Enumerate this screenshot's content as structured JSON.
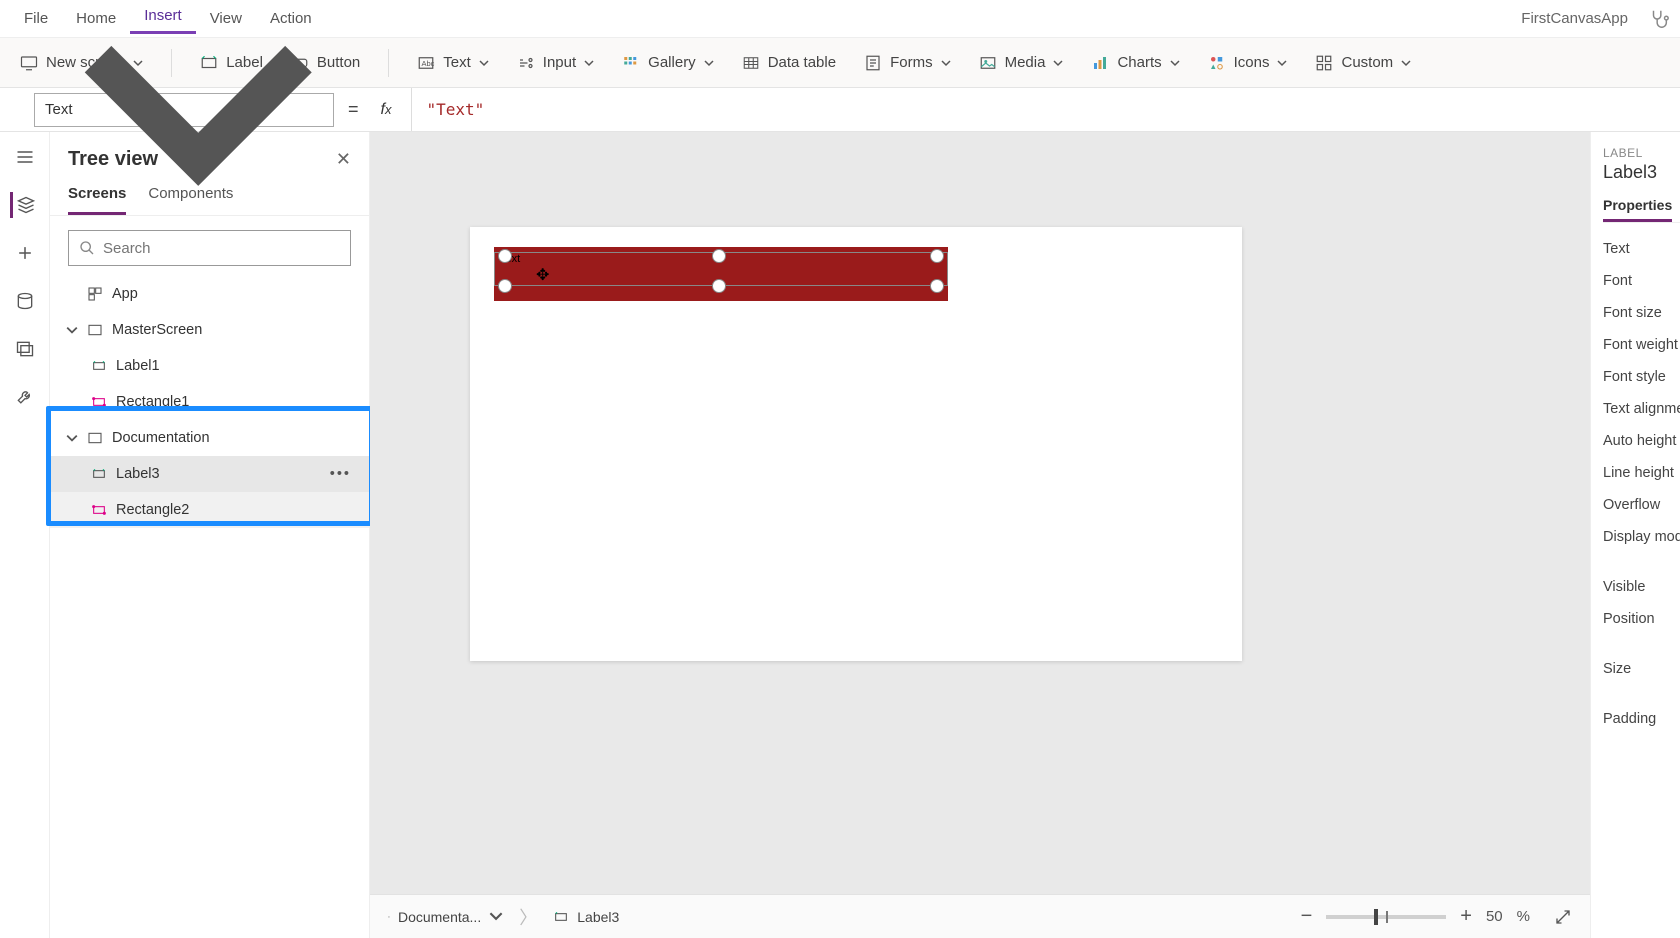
{
  "app_name": "FirstCanvasApp",
  "menu": {
    "items": [
      "File",
      "Home",
      "Insert",
      "View",
      "Action"
    ],
    "active": "Insert"
  },
  "ribbon": {
    "new_screen": "New screen",
    "label": "Label",
    "button": "Button",
    "text": "Text",
    "input": "Input",
    "gallery": "Gallery",
    "data_table": "Data table",
    "forms": "Forms",
    "media": "Media",
    "charts": "Charts",
    "icons": "Icons",
    "custom": "Custom"
  },
  "formula": {
    "property": "Text",
    "value": "\"Text\""
  },
  "tree": {
    "title": "Tree view",
    "tabs": [
      "Screens",
      "Components"
    ],
    "active_tab": "Screens",
    "search_placeholder": "Search",
    "app_label": "App",
    "items": [
      {
        "name": "MasterScreen",
        "type": "screen",
        "children": [
          {
            "name": "Label1",
            "type": "label"
          },
          {
            "name": "Rectangle1",
            "type": "rect"
          }
        ]
      },
      {
        "name": "Documentation",
        "type": "screen",
        "children": [
          {
            "name": "Label3",
            "type": "label",
            "selected": true
          },
          {
            "name": "Rectangle2",
            "type": "rect"
          }
        ]
      }
    ]
  },
  "canvas": {
    "selected_label_text": "Text"
  },
  "breadcrumb": {
    "screen": "Documenta...",
    "control": "Label3"
  },
  "zoom": {
    "value": "50",
    "unit": "%"
  },
  "properties": {
    "category": "LABEL",
    "control_name": "Label3",
    "tab": "Properties",
    "rows": [
      "Text",
      "Font",
      "Font size",
      "Font weight",
      "Font style",
      "Text alignment",
      "Auto height",
      "Line height",
      "Overflow",
      "Display mode"
    ],
    "rows2": [
      "Visible",
      "Position",
      "Size",
      "Padding"
    ]
  }
}
